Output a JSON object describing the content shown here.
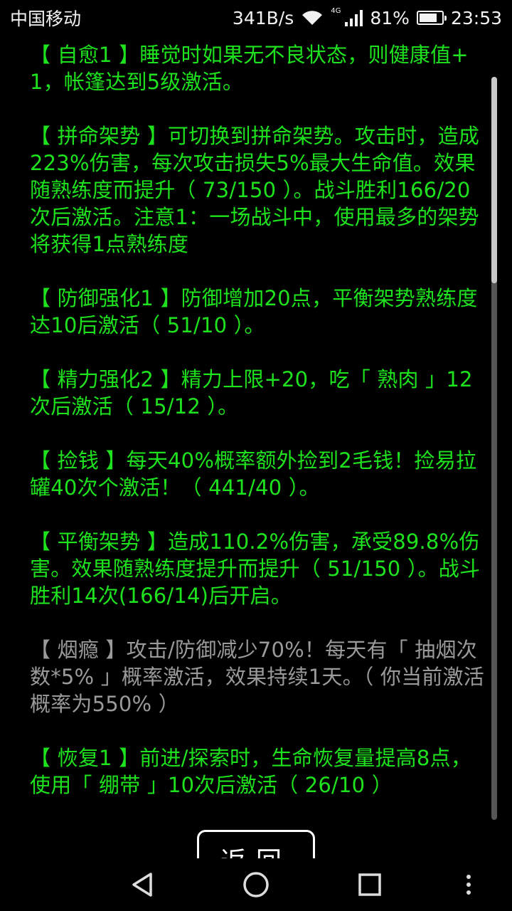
{
  "status_bar": {
    "carrier": "中国移动",
    "net_speed": "341B/s",
    "network_type": "4G",
    "battery_percent": "81%",
    "battery_level": 0.81,
    "time": "23:53"
  },
  "entries": [
    {
      "text": "【 自愈1 】睡觉时如果无不良状态，则健康值+1，帐篷达到5级激活。",
      "status": "active"
    },
    {
      "text": "【 拼命架势 】可切换到拼命架势。攻击时，造成223%伤害，每次攻击损失5%最大生命值。效果随熟练度而提升（ 73/150 ）。战斗胜利166/20次后激活。注意1：一场战斗中，使用最多的架势将获得1点熟练度",
      "status": "active"
    },
    {
      "text": "【 防御强化1 】防御增加20点，平衡架势熟练度达10后激活（ 51/10 ）。",
      "status": "active"
    },
    {
      "text": "【 精力强化2 】精力上限+20，吃「 熟肉 」12次后激活（ 15/12 ）。",
      "status": "active"
    },
    {
      "text": "【 捡钱 】每天40%概率额外捡到2毛钱！捡易拉罐40次个激活！（ 441/40 ）。",
      "status": "active"
    },
    {
      "text": "【 平衡架势 】造成110.2%伤害，承受89.8%伤害。效果随熟练度提升而提升（ 51/150 ）。战斗胜利14次(166/14)后开启。",
      "status": "active"
    },
    {
      "text": "【 烟瘾 】攻击/防御减少70%！每天有「 抽烟次数*5% 」概率激活，效果持续1天。（ 你当前激活概率为550% ）",
      "status": "inactive"
    },
    {
      "text": "【 恢复1 】前进/探索时，生命恢复量提高8点，使用「 绷带 」10次后激活（ 26/10 ）",
      "status": "active"
    }
  ],
  "back_button": {
    "label": "返回"
  },
  "nav": {
    "back_icon": "triangle-back-icon",
    "home_icon": "circle-home-icon",
    "recents_icon": "square-recents-icon",
    "menu_icon": "three-dot-menu-icon"
  },
  "colors": {
    "active_text": "#1ee21e",
    "inactive_text": "#9a9a9a",
    "background": "#000000"
  }
}
